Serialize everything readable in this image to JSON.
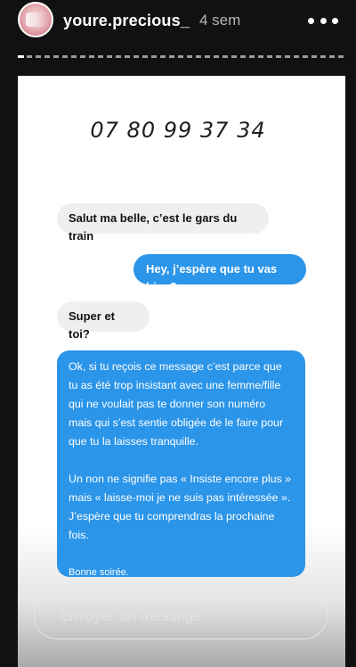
{
  "header": {
    "username": "youre.precious_",
    "timeago": "4 sem",
    "story_progress": 0.02
  },
  "post": {
    "phone_number": "07 80 99 37 34",
    "messages": [
      {
        "from": "received",
        "text": "Salut ma belle, c’est le gars du train"
      },
      {
        "from": "sent",
        "text": "Hey, j’espère que tu vas bien?"
      },
      {
        "from": "received",
        "text": "Super et toi?"
      }
    ],
    "long_message": {
      "from": "sent",
      "lines": [
        "Ok, si tu reçois ce message c’est parce que",
        "tu as été trop insistant avec une femme/fille",
        "qui ne voulait pas te donner son numéro",
        "mais qui s’est sentie obligée de le faire pour",
        "que tu la laisses tranquille."
      ],
      "lines2": [
        "Un non ne signifie pas « Insiste encore plus »",
        "mais « laisse-moi je ne suis pas intéressée ».",
        "J’espère que tu comprendras la prochaine",
        "fois."
      ],
      "signoff": "Bonne soirée."
    }
  },
  "reply": {
    "placeholder": "Envoyer un message"
  },
  "colors": {
    "background": "#111111",
    "sent_bubble": "#2b95e9",
    "received_bubble": "#efefef"
  }
}
